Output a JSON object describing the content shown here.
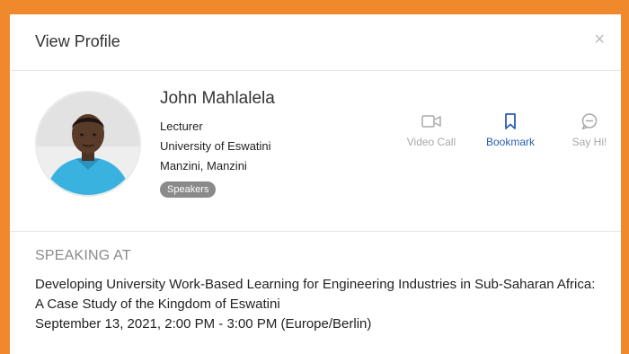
{
  "modal": {
    "title": "View Profile",
    "close_label": "×"
  },
  "profile": {
    "name": "John Mahlalela",
    "role": "Lecturer",
    "organization": "University of Eswatini",
    "location": "Manzini, Manzini",
    "badge": "Speakers"
  },
  "actions": {
    "video_call": "Video Call",
    "bookmark": "Bookmark",
    "say_hi": "Say Hi!"
  },
  "speaking": {
    "heading": "SPEAKING AT",
    "session_title": "Developing University Work-Based Learning for Engineering Industries in Sub-Saharan Africa: A Case Study of the Kingdom of Eswatini",
    "session_time": "September 13, 2021, 2:00 PM - 3:00 PM (Europe/Berlin)"
  },
  "colors": {
    "frame": "#f0892c",
    "accent": "#2a5db0",
    "muted": "#a8a8a8",
    "badge": "#8a8a8a"
  }
}
